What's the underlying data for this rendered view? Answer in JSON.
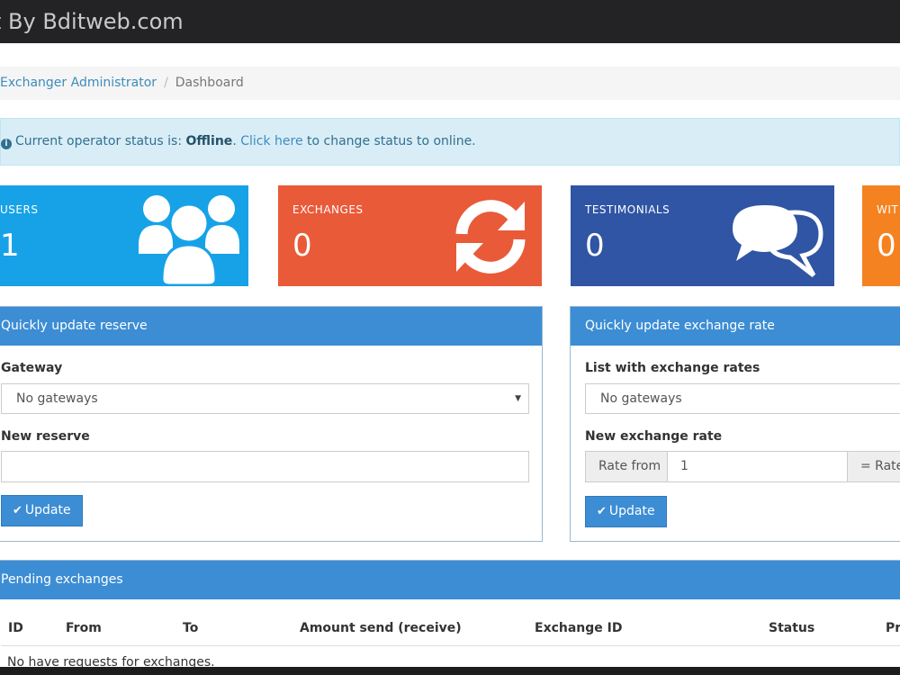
{
  "watermark": {
    "text": "t By Bditweb.com"
  },
  "breadcrumb": {
    "root": "Exchanger Administrator",
    "current": "Dashboard"
  },
  "alert": {
    "prefix": "Current operator status is: ",
    "status": "Offline",
    "dot": ".",
    "link": "Click here",
    "suffix": " to change status to online."
  },
  "stats": [
    {
      "label": "USERS",
      "value": "1",
      "color": "#17a2e8",
      "icon": "users-icon"
    },
    {
      "label": "EXCHANGES",
      "value": "0",
      "color": "#e95a39",
      "icon": "refresh-icon"
    },
    {
      "label": "TESTIMONIALS",
      "value": "0",
      "color": "#2f55a4",
      "icon": "comments-icon"
    },
    {
      "label": "WIT",
      "value": "0",
      "color": "#f58220",
      "icon": ""
    }
  ],
  "reserve_panel": {
    "title": "Quickly update reserve",
    "gateway_label": "Gateway",
    "gateway_value": "No gateways",
    "reserve_label": "New reserve",
    "reserve_value": "",
    "button": "Update"
  },
  "rate_panel": {
    "title": "Quickly update exchange rate",
    "list_label": "List with exchange rates",
    "list_value": "No gateways",
    "rate_label": "New exchange rate",
    "rate_from_addon": "Rate from",
    "rate_from_value": "1",
    "rate_to_addon": "= Rate",
    "button": "Update"
  },
  "pending": {
    "title": "Pending exchanges",
    "columns": [
      "ID",
      "From",
      "To",
      "Amount send (receive)",
      "Exchange ID",
      "Status",
      "Pr"
    ],
    "empty": "No have requests for exchanges."
  },
  "colors": {
    "primary": "#3c8dd4",
    "alert_bg": "#d9edf7",
    "alert_text": "#31708f"
  }
}
